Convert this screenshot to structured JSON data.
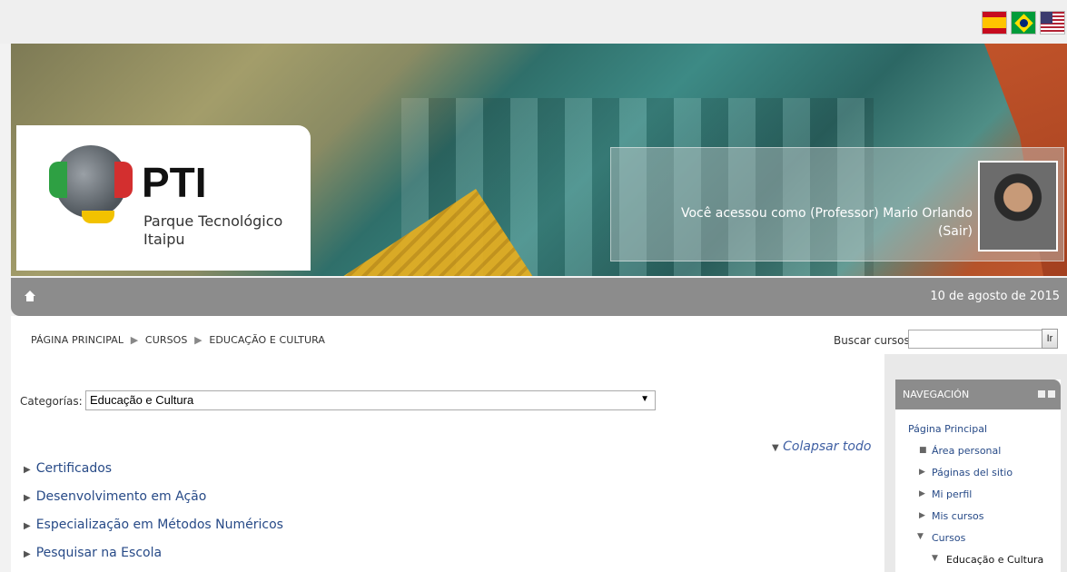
{
  "flags": {
    "spanish": "flag-spain-icon",
    "portuguese": "flag-brazil-icon",
    "english": "flag-usa-icon"
  },
  "logo": {
    "title": "PTI",
    "subtitle_line1": "Parque Tecnológico",
    "subtitle_line2": "Itaipu"
  },
  "user": {
    "login_text": "Você acessou como (Professor) Mario Orlando",
    "logout_label": "(Sair)"
  },
  "navbar": {
    "home_icon": "home-icon",
    "date": "10 de agosto de 2015"
  },
  "breadcrumb": {
    "items": [
      "PÁGINA PRINCIPAL",
      "CURSOS",
      "EDUCAÇÃO E CULTURA"
    ],
    "separator": "▶"
  },
  "search": {
    "label": "Buscar cursos:",
    "value": "",
    "button_label": "Ir"
  },
  "category": {
    "label": "Categorías:",
    "selected": "Educação e Cultura"
  },
  "collapse_all": "Colapsar todo",
  "courses": [
    "Certificados",
    "Desenvolvimento em Ação",
    "Especialização em Métodos Numéricos",
    "Pesquisar na Escola"
  ],
  "navigation": {
    "title": "NAVEGACIÓN",
    "items": [
      {
        "label": "Página Principal"
      },
      {
        "label": "Área personal"
      },
      {
        "label": "Páginas del sitio"
      },
      {
        "label": "Mi perfil"
      },
      {
        "label": "Mis cursos"
      },
      {
        "label": "Cursos"
      },
      {
        "label": "Educação e Cultura"
      }
    ]
  }
}
